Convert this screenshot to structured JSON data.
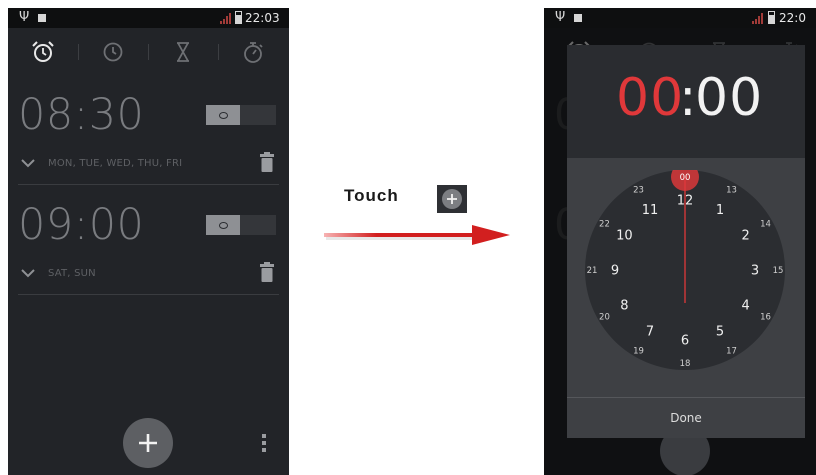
{
  "left_screen": {
    "status": {
      "time": "22:03"
    },
    "tabs": [
      {
        "name": "alarm"
      },
      {
        "name": "clock"
      },
      {
        "name": "timer"
      },
      {
        "name": "stopwatch"
      }
    ],
    "alarms": [
      {
        "time": "08:30",
        "days": "MON, TUE, WED, THU, FRI",
        "enabled": true
      },
      {
        "time": "09:00",
        "days": "SAT, SUN",
        "enabled": true
      }
    ],
    "fab_icon": "plus-icon",
    "menu_icon": "overflow-menu-icon"
  },
  "middle": {
    "touch_label": "Touch",
    "touch_icon": "add-button-icon",
    "arrow_color": "#d21f1f"
  },
  "right_screen": {
    "status": {
      "time": "22:0"
    },
    "background_times": [
      "0",
      "0"
    ],
    "time_picker": {
      "hours": "00",
      "separator": ":",
      "minutes": "00",
      "accent_color": "#e0383a",
      "selected_hour": "00",
      "inner_hours": [
        "12",
        "1",
        "2",
        "3",
        "4",
        "5",
        "6",
        "7",
        "8",
        "9",
        "10",
        "11"
      ],
      "outer_hours": [
        "00",
        "13",
        "14",
        "15",
        "16",
        "17",
        "18",
        "19",
        "20",
        "21",
        "22",
        "23"
      ],
      "done_label": "Done"
    }
  }
}
